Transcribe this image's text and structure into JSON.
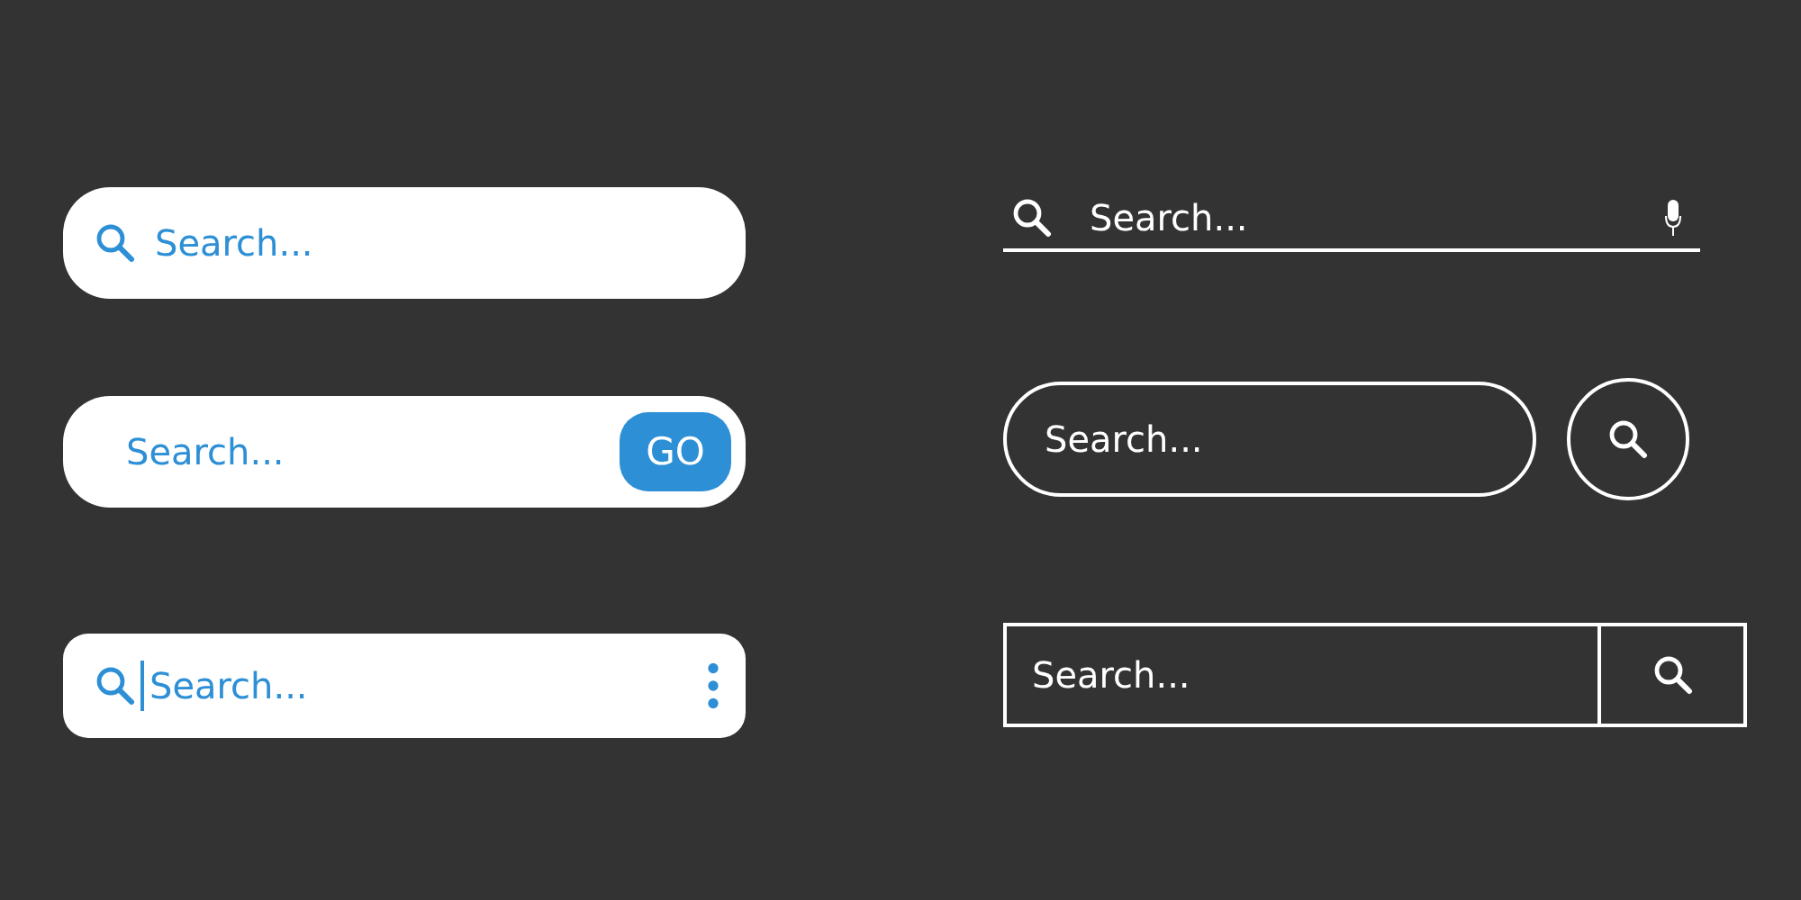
{
  "left_column": [
    {
      "kind": "pill-icon",
      "placeholder": "Search..."
    },
    {
      "kind": "pill-go",
      "placeholder": "Search...",
      "button": "GO"
    },
    {
      "kind": "cursor-menu",
      "placeholder": "Search..."
    }
  ],
  "right_column": [
    {
      "kind": "underline-mic",
      "placeholder": "Search..."
    },
    {
      "kind": "outline-round-button",
      "placeholder": "Search..."
    },
    {
      "kind": "box-button",
      "placeholder": "Search..."
    }
  ]
}
